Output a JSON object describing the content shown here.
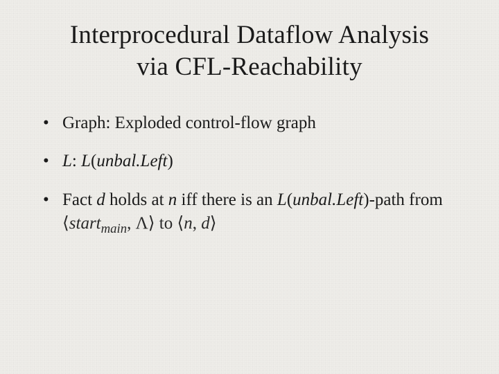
{
  "title_line1": "Interprocedural Dataflow Analysis",
  "title_line2": "via  CFL-Reachability",
  "bullets": {
    "b1": "Graph: Exploded control-flow graph",
    "b2_prefix": "L",
    "b2_colon": ": ",
    "b2_func": "L",
    "b2_paren_open": "(",
    "b2_arg": "unbal.Left",
    "b2_paren_close": ")",
    "b3_a": "Fact ",
    "b3_d": "d",
    "b3_b": " holds at ",
    "b3_n": "n",
    "b3_c": " iff there is an ",
    "b3_func": "L",
    "b3_paren_open": "(",
    "b3_arg": "unbal.Left",
    "b3_paren_close": ")",
    "b3_d2": "-path from ",
    "math_open1": "⟨",
    "math_start": "start",
    "math_sub": "main",
    "math_comma1": ", ",
    "math_lambda": "Λ",
    "math_close1": "⟩",
    "math_to": " to ",
    "math_open2": "⟨",
    "math_n": "n",
    "math_comma2": ", ",
    "math_dd": "d",
    "math_close2": "⟩"
  }
}
